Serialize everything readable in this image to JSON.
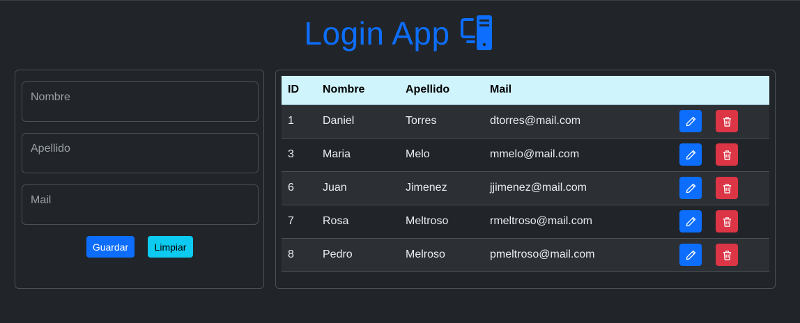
{
  "header": {
    "title": "Login App",
    "icon": "computer-monitor-icon",
    "color": "#0d6efd"
  },
  "form": {
    "fields": [
      {
        "label": "Nombre",
        "value": ""
      },
      {
        "label": "Apellido",
        "value": ""
      },
      {
        "label": "Mail",
        "value": ""
      }
    ],
    "save_label": "Guardar",
    "clear_label": "Limpiar"
  },
  "table": {
    "columns": [
      "ID",
      "Nombre",
      "Apellido",
      "Mail"
    ],
    "rows": [
      {
        "id": "1",
        "nombre": "Daniel",
        "apellido": "Torres",
        "mail": "dtorres@mail.com"
      },
      {
        "id": "3",
        "nombre": "Maria",
        "apellido": "Melo",
        "mail": "mmelo@mail.com"
      },
      {
        "id": "6",
        "nombre": "Juan",
        "apellido": "Jimenez",
        "mail": "jjimenez@mail.com"
      },
      {
        "id": "7",
        "nombre": "Rosa",
        "apellido": "Meltroso",
        "mail": "rmeltroso@mail.com"
      },
      {
        "id": "8",
        "nombre": "Pedro",
        "apellido": "Melroso",
        "mail": "pmeltroso@mail.com"
      }
    ],
    "row_actions": [
      "pencil-icon",
      "trash-icon"
    ]
  },
  "colors": {
    "background": "#212529",
    "primary": "#0d6efd",
    "info": "#0dcaf0",
    "danger": "#dc3545",
    "table_header": "#cff4fc"
  }
}
